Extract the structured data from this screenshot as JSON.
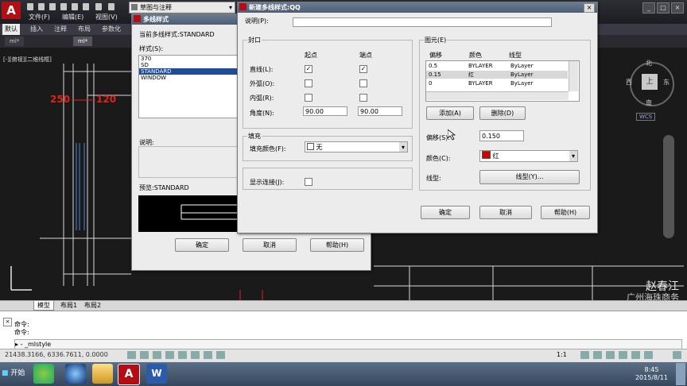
{
  "app": {
    "logo": "A",
    "workspace": "草图与注释",
    "menus": [
      "文件(F)",
      "编辑(E)",
      "视图(V)"
    ],
    "ribbon_tabs": [
      "默认",
      "插入",
      "注释",
      "布局",
      "参数化"
    ],
    "doc_tabs": [
      "ml*",
      "ml*"
    ],
    "view_label": "[-][俯视][二维线框]",
    "dim_left": "250",
    "dim_right": "120",
    "author_line1": "赵春江",
    "author_line2": "广州海珠商务",
    "compass": {
      "north": "北",
      "south": "南",
      "east": "东",
      "west": "西",
      "top": "上"
    },
    "wcs": "WCS",
    "layout_tabs": [
      "模型",
      "布局1",
      "布局2"
    ],
    "cmd_lines": [
      "命令:",
      "命令:"
    ],
    "cmd_input": "- _mlstyle",
    "coords": "21438.3166, 6336.7611, 0.0000",
    "annotation_scale": "1:1",
    "start_label": "开始",
    "clock_time": "8:45",
    "clock_date": "2015/8/11",
    "colors": {
      "accent_red": "#b40d13",
      "dimension_red": "#e0221b",
      "title_blue": "#4d5d72"
    }
  },
  "mlstyle_dialog": {
    "title": "多线样式",
    "current_style_label": "当前多线样式:STANDARD",
    "styles_label": "样式(S):",
    "styles": [
      "370",
      "SD",
      "STANDARD",
      "WINDOW"
    ],
    "selected_style": "STANDARD",
    "description_label": "说明:",
    "preview_label": "预览:STANDARD",
    "ok": "确定",
    "cancel": "取消",
    "help": "帮助(H)"
  },
  "new_style_dialog": {
    "title": "新建多线样式:QQ",
    "description_label": "说明(P):",
    "description_value": "",
    "caps": {
      "group_title": "封口",
      "start_header": "起点",
      "end_header": "端点",
      "rows": [
        {
          "label": "直线(L):",
          "start": true,
          "end": true
        },
        {
          "label": "外弧(O):",
          "start": false,
          "end": false
        },
        {
          "label": "内弧(R):",
          "start": false,
          "end": false
        }
      ],
      "angle_label": "角度(N):",
      "angle_start": "90.00",
      "angle_end": "90.00"
    },
    "fill": {
      "group_title": "填充",
      "color_label": "填充颜色(F):",
      "color_value": "无"
    },
    "joints": {
      "label": "显示连接(J):",
      "checked": false
    },
    "elements": {
      "group_title": "图元(E)",
      "headers": [
        "偏移",
        "颜色",
        "线型"
      ],
      "rows": [
        {
          "offset": "0.5",
          "color": "BYLAYER",
          "linetype": "ByLayer"
        },
        {
          "offset": "0.15",
          "color": "红",
          "linetype": "ByLayer"
        },
        {
          "offset": "0",
          "color": "BYLAYER",
          "linetype": "ByLayer"
        }
      ],
      "add_button": "添加(A)",
      "delete_button": "删除(D)",
      "offset_label": "偏移(S):",
      "offset_value": "0.150",
      "color_label": "颜色(C):",
      "color_value": "红",
      "color_swatch": "#d40000",
      "linetype_label": "线型:",
      "linetype_button": "线型(Y)..."
    },
    "ok": "确定",
    "cancel": "取消",
    "help": "帮助(H)"
  }
}
